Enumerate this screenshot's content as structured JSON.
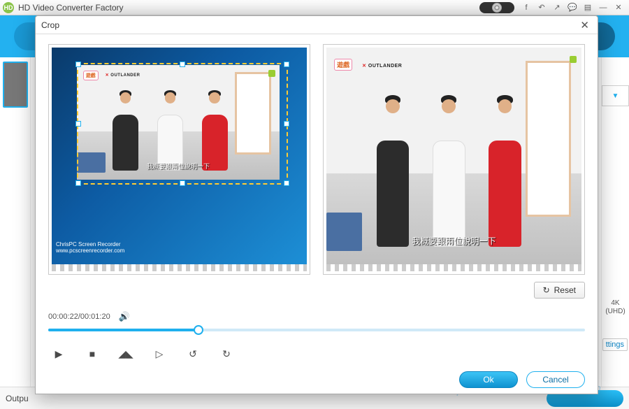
{
  "app": {
    "logo_text": "HD",
    "title": "HD Video Converter Factory"
  },
  "titlebar_icons": [
    "facebook-icon",
    "undo-icon",
    "redo-icon",
    "comment-icon",
    "note-icon",
    "minimize",
    "close"
  ],
  "right_panel": {
    "format_top": "4K",
    "format_bottom": "(UHD)",
    "settings": "ttings"
  },
  "footer": {
    "output_label": "Outpu"
  },
  "modal": {
    "title": "Crop",
    "reset_label": "Reset",
    "ok_label": "Ok",
    "cancel_label": "Cancel",
    "time_current": "00:00:22",
    "time_sep": "/",
    "time_total": "00:01:20",
    "progress_pct": 28
  },
  "scene": {
    "logo_brand": "遊戲",
    "logo_text": "OUTLANDER",
    "subtitle": "我概要跟兩位說明一下"
  },
  "left_watermark": {
    "line1": "ChrisPC Screen Recorder",
    "line2": "www.pcscreenrecorder.com"
  }
}
